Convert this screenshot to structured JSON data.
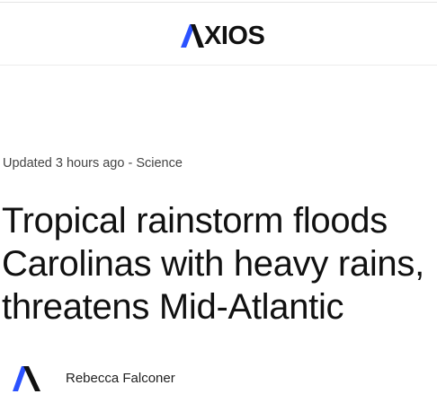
{
  "header": {
    "logo_text": "XIOS",
    "logo_icon": "axios-a-icon",
    "brand_color": "#2b52ff"
  },
  "article": {
    "meta": {
      "updated": "Updated 3 hours ago",
      "separator": " - ",
      "category": "Science"
    },
    "headline": "Tropical rainstorm floods Carolinas with heavy rains, threatens Mid-Atlantic",
    "byline": {
      "avatar_icon": "axios-a-icon",
      "author": "Rebecca Falconer"
    }
  }
}
